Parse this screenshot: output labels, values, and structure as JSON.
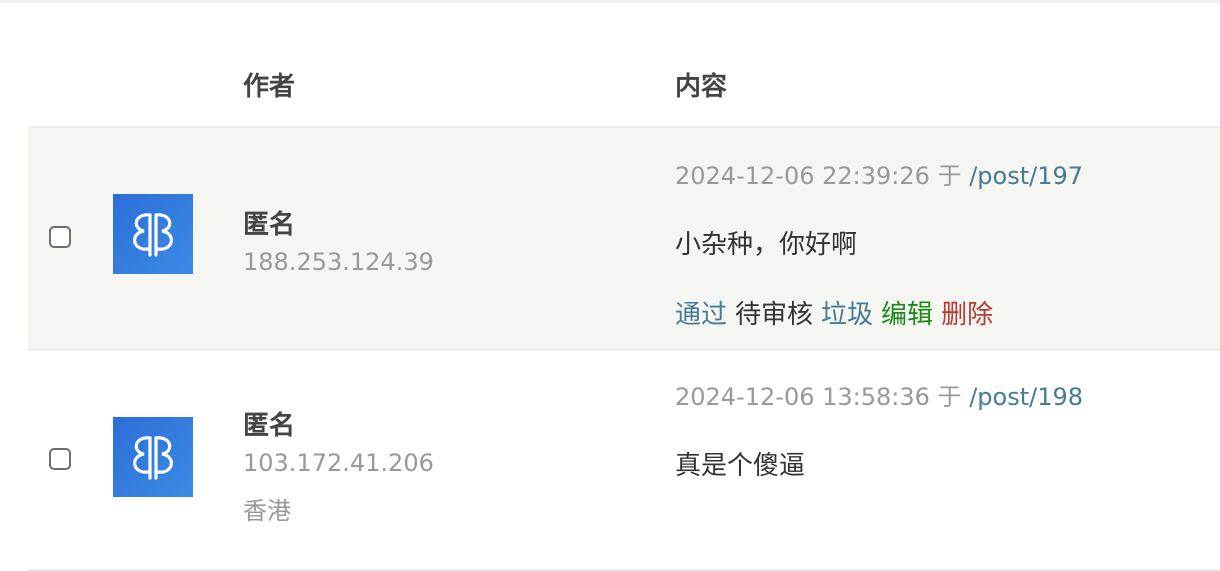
{
  "header": {
    "author": "作者",
    "content": "内容"
  },
  "comments": [
    {
      "author": "匿名",
      "ip": "188.253.124.39",
      "location": "",
      "date": "2024-12-06 22:39:26",
      "at": "于",
      "post": "/post/197",
      "text": "小杂种，你好啊",
      "actions": {
        "approve": "通过",
        "pending": "待审核",
        "spam": "垃圾",
        "edit": "编辑",
        "delete": "删除"
      }
    },
    {
      "author": "匿名",
      "ip": "103.172.41.206",
      "location": "香港",
      "date": "2024-12-06 13:58:36",
      "at": "于",
      "post": "/post/198",
      "text": "真是个傻逼"
    }
  ],
  "colors": {
    "link": "#467b96",
    "edit": "#1a8a1a",
    "delete": "#b93a34",
    "avatar": "#2c6ed8",
    "highlight_row": "#f5f5f2"
  },
  "icons": {
    "avatar": "identicon-avatar"
  }
}
